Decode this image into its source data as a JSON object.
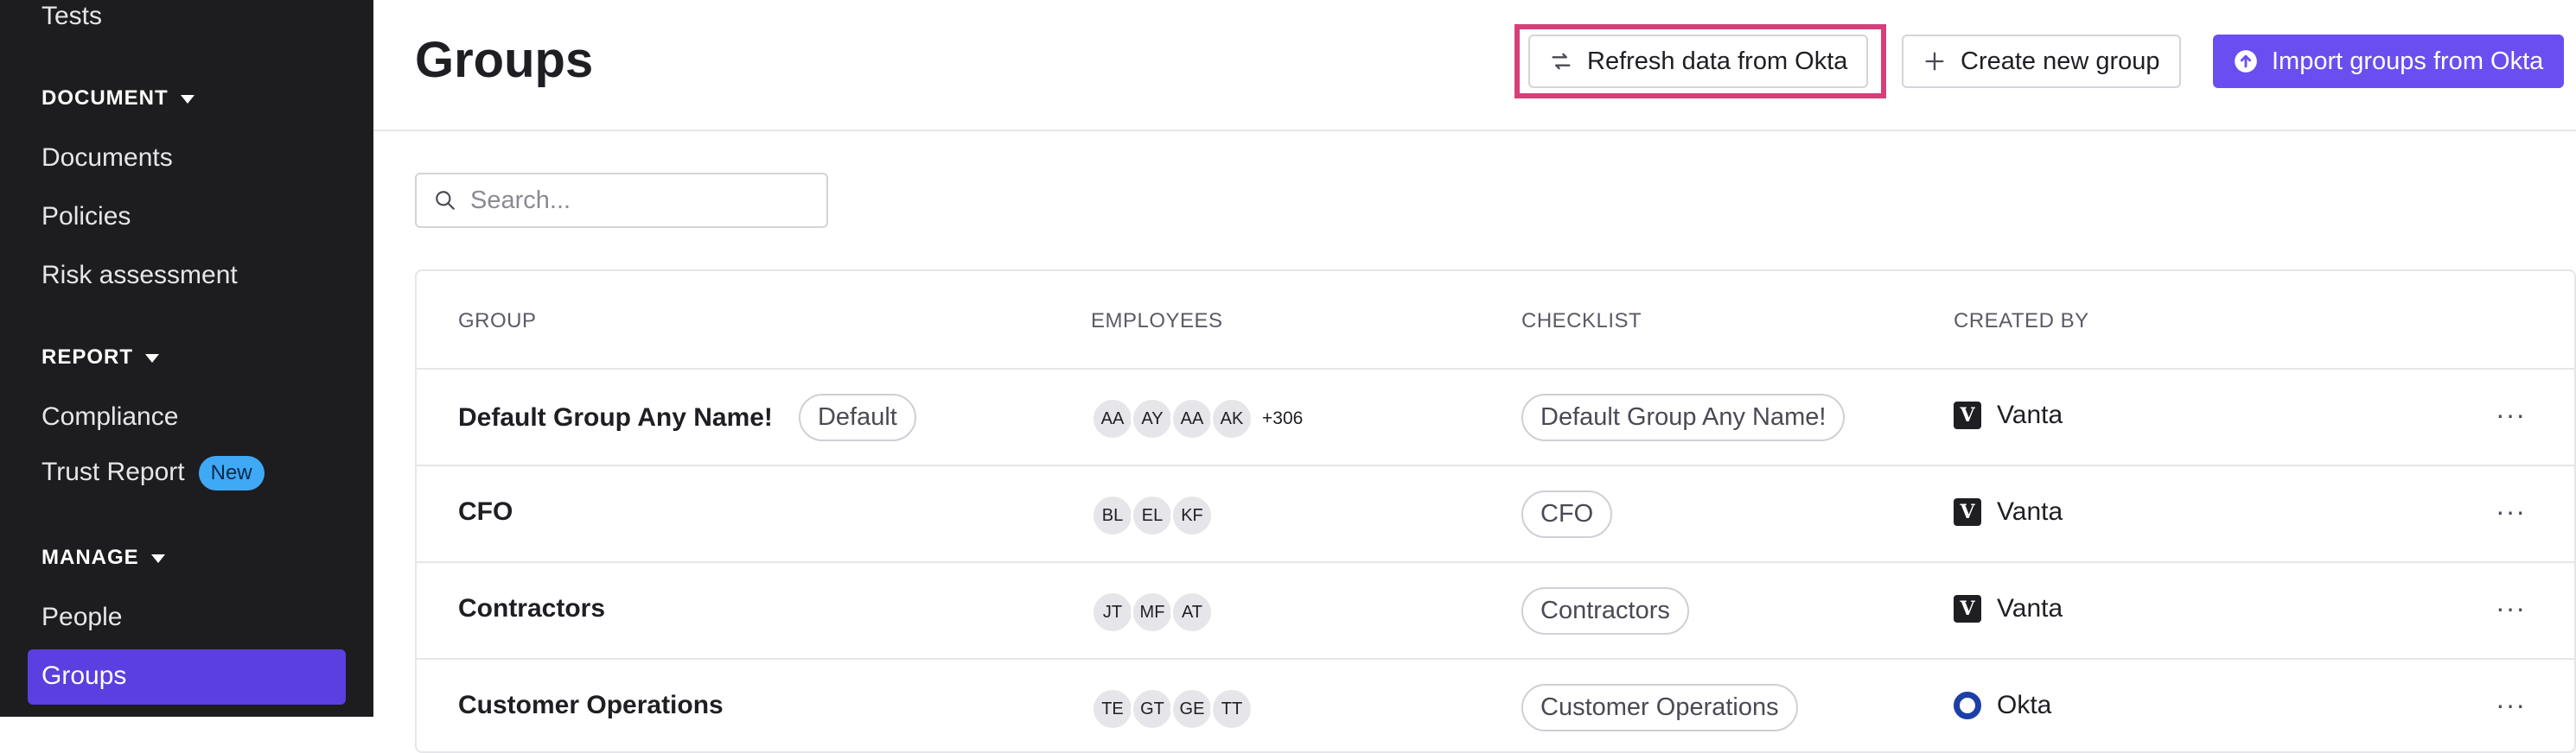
{
  "sidebar": {
    "items": [
      {
        "label": "Tests"
      },
      {
        "section": "DOCUMENT"
      },
      {
        "label": "Documents"
      },
      {
        "label": "Policies"
      },
      {
        "label": "Risk assessment"
      },
      {
        "section": "REPORT"
      },
      {
        "label": "Compliance"
      },
      {
        "label": "Trust Report",
        "badge": "New"
      },
      {
        "section": "MANAGE"
      },
      {
        "label": "People"
      },
      {
        "label": "Groups",
        "active": true
      }
    ]
  },
  "header": {
    "title": "Groups",
    "refresh_label": "Refresh data from Okta",
    "create_label": "Create new group",
    "import_label": "Import groups from Okta"
  },
  "search": {
    "placeholder": "Search..."
  },
  "table": {
    "columns": [
      "GROUP",
      "EMPLOYEES",
      "CHECKLIST",
      "CREATED BY"
    ],
    "rows": [
      {
        "group": "Default Group Any Name!",
        "tag": "Default",
        "avatars": [
          "AA",
          "AY",
          "AA",
          "AK"
        ],
        "more": "+306",
        "checklist": "Default Group Any Name!",
        "created_by": "Vanta",
        "creator_icon": "vanta-logo-icon"
      },
      {
        "group": "CFO",
        "avatars": [
          "BL",
          "EL",
          "KF"
        ],
        "checklist": "CFO",
        "created_by": "Vanta",
        "creator_icon": "vanta-logo-icon"
      },
      {
        "group": "Contractors",
        "avatars": [
          "JT",
          "MF",
          "AT"
        ],
        "checklist": "Contractors",
        "created_by": "Vanta",
        "creator_icon": "vanta-logo-icon"
      },
      {
        "group": "Customer Operations",
        "avatars": [
          "TE",
          "GT",
          "GE",
          "TT"
        ],
        "checklist": "Customer Operations",
        "created_by": "Okta",
        "creator_icon": "okta-logo-icon"
      }
    ],
    "row_menu": "···"
  },
  "colors": {
    "sidebar_bg": "#1d1d1f",
    "accent": "#6a4ef0",
    "active_nav": "#5b3fe0",
    "highlight": "#d63f7a",
    "badge_new": "#3fa9f5"
  }
}
